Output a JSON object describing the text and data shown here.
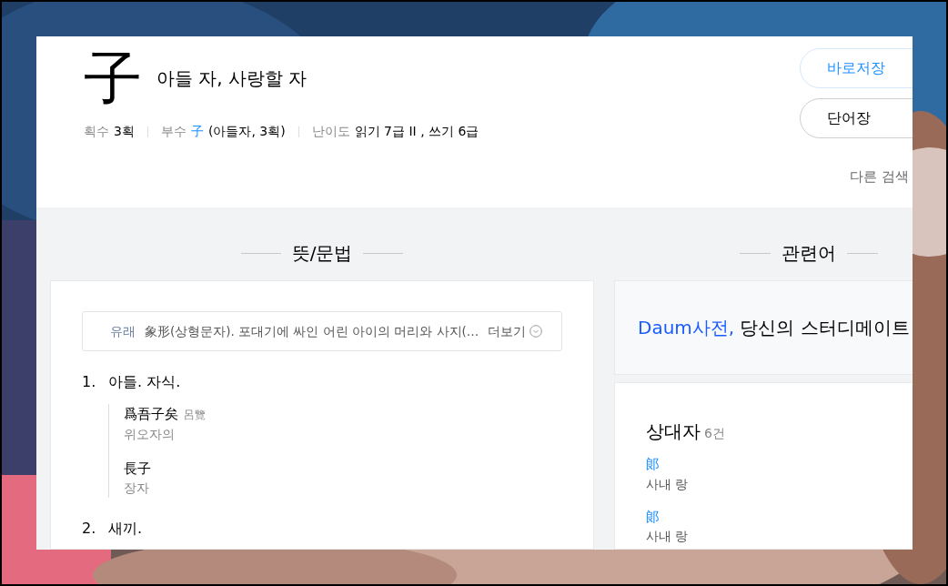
{
  "hanja": {
    "character": "子",
    "meaning": "아들 자, 사랑할 자"
  },
  "meta": [
    {
      "label": "획수",
      "value": "3획"
    },
    {
      "label": "부수",
      "link": "子",
      "value": "(아들자, 3획)"
    },
    {
      "label": "난이도",
      "value": "읽기 7급 II , 쓰기 6급"
    }
  ],
  "buttons": [
    {
      "label": "바로저장",
      "kind": "primary"
    },
    {
      "label": "단어장",
      "kind": "default"
    }
  ],
  "other_search": "다른 검색",
  "meaning_section": {
    "title": "뜻/문법",
    "origin": {
      "label": "유래",
      "text": "象形(상형문자). 포대기에 싸인 어린 아이의 머리와 사지(…",
      "more": "더보기"
    },
    "meanings": [
      {
        "number": "1.",
        "text": "아들. 자식.",
        "examples": [
          {
            "hanja": "爲吾子矣",
            "source": "呂覽",
            "reading": "위오자의"
          },
          {
            "hanja": "長子",
            "reading": "장자"
          }
        ]
      },
      {
        "number": "2.",
        "text": "새끼."
      }
    ]
  },
  "related_section": {
    "title": "관련어",
    "promo": {
      "brand": "Daum사전,",
      "text": "당신의 스터디메이트"
    },
    "antonyms": {
      "title": "상대자",
      "count": "6건",
      "items": [
        {
          "hanja": "郞",
          "reading": "사내 랑"
        },
        {
          "hanja": "郞",
          "reading": "사내 랑"
        }
      ]
    }
  }
}
